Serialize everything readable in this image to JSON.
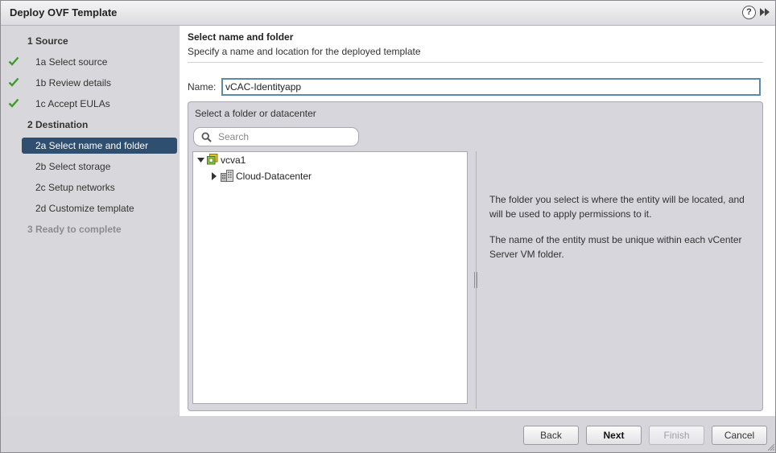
{
  "window": {
    "title": "Deploy OVF Template",
    "help_icon": "?"
  },
  "steps": [
    {
      "label": "1  Source",
      "kind": "main"
    },
    {
      "label": "1a  Select source",
      "kind": "sub",
      "checked": true
    },
    {
      "label": "1b  Review details",
      "kind": "sub",
      "checked": true
    },
    {
      "label": "1c  Accept EULAs",
      "kind": "sub",
      "checked": true
    },
    {
      "label": "2  Destination",
      "kind": "main"
    },
    {
      "label": "2a  Select name and folder",
      "kind": "sub",
      "active": true
    },
    {
      "label": "2b  Select storage",
      "kind": "sub"
    },
    {
      "label": "2c  Setup networks",
      "kind": "sub"
    },
    {
      "label": "2d  Customize template",
      "kind": "sub"
    },
    {
      "label": "3  Ready to complete",
      "kind": "main",
      "disabled": true
    }
  ],
  "page": {
    "heading": "Select name and folder",
    "subheading": "Specify a name and location for the deployed template",
    "name_label": "Name:",
    "name_value": "vCAC-Identityapp"
  },
  "folder_panel": {
    "label": "Select a folder or datacenter",
    "search_placeholder": "Search",
    "tree": [
      {
        "label": "vcva1",
        "icon": "vcenter-icon",
        "expanded": true
      },
      {
        "label": "Cloud-Datacenter",
        "icon": "datacenter-icon",
        "expanded": false
      }
    ],
    "info": [
      "The folder you select is where the entity will be located, and will be used to apply permissions to it.",
      "The name of the entity must be unique within each vCenter Server VM folder."
    ]
  },
  "buttons": {
    "back": "Back",
    "next": "Next",
    "finish": "Finish",
    "cancel": "Cancel"
  },
  "colors": {
    "accent": "#2f4f71",
    "check": "#3f9a2a",
    "input_border": "#5c8aa6"
  }
}
